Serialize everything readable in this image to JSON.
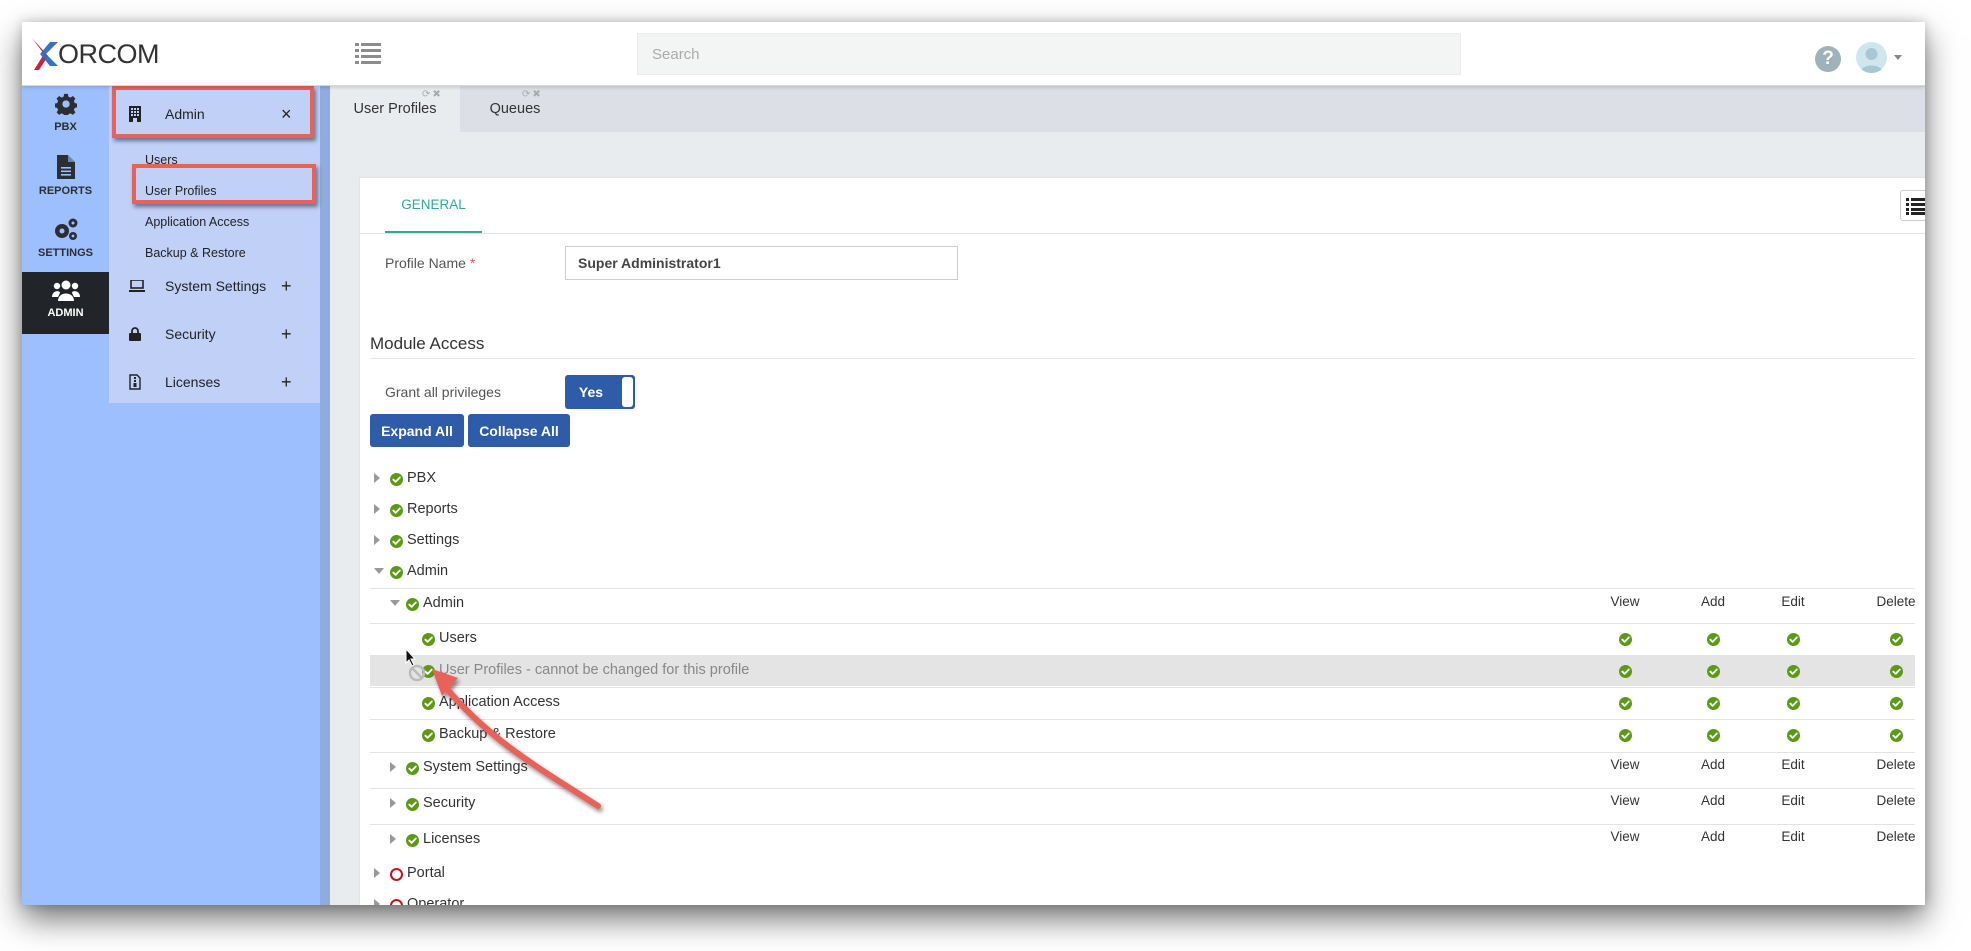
{
  "header": {
    "logo_x": "X",
    "logo_text": "ORCOM",
    "search_placeholder": "Search",
    "search_value": ""
  },
  "iconbar": [
    {
      "label": "PBX",
      "icon": "gear-icon",
      "active": false
    },
    {
      "label": "REPORTS",
      "icon": "document-icon",
      "active": false
    },
    {
      "label": "SETTINGS",
      "icon": "gears-icon",
      "active": false
    },
    {
      "label": "ADMIN",
      "icon": "users-icon",
      "active": true
    }
  ],
  "submenu": {
    "admin": {
      "label": "Admin",
      "action": "×",
      "icon": "building-icon"
    },
    "admin_items": [
      "Users",
      "User Profiles",
      "Application Access",
      "Backup & Restore"
    ],
    "sections": [
      {
        "label": "System Settings",
        "action": "+",
        "icon": "laptop-icon"
      },
      {
        "label": "Security",
        "action": "+",
        "icon": "lock-icon"
      },
      {
        "label": "Licenses",
        "action": "+",
        "icon": "file-zip-icon"
      }
    ]
  },
  "tabs": [
    {
      "label": "User Profiles",
      "active": true
    },
    {
      "label": "Queues",
      "active": false
    }
  ],
  "content": {
    "tab_label": "GENERAL",
    "profile_name_label": "Profile Name",
    "required_mark": "*",
    "profile_name_value": "Super Administrator1",
    "section_title": "Module Access",
    "grant_label": "Grant all privileges",
    "grant_value": "Yes",
    "expand_all": "Expand All",
    "collapse_all": "Collapse All"
  },
  "permissions": {
    "columns": [
      "View",
      "Add",
      "Edit",
      "Delete"
    ]
  },
  "tree": [
    {
      "label": "PBX",
      "level": 0,
      "state": "collapsed",
      "checked": true
    },
    {
      "label": "Reports",
      "level": 0,
      "state": "collapsed",
      "checked": true
    },
    {
      "label": "Settings",
      "level": 0,
      "state": "collapsed",
      "checked": true
    },
    {
      "label": "Admin",
      "level": 0,
      "state": "expanded",
      "checked": true
    },
    {
      "label": "Admin",
      "level": 1,
      "state": "expanded",
      "checked": true,
      "perm_headers": true
    },
    {
      "label": "Users",
      "level": 2,
      "checked": true,
      "perms": [
        true,
        true,
        true,
        true
      ]
    },
    {
      "label": "User Profiles - cannot be changed for this profile",
      "level": 2,
      "checked": true,
      "disabled": true,
      "perms": [
        true,
        true,
        true,
        true
      ]
    },
    {
      "label": "Application Access",
      "level": 2,
      "checked": true,
      "perms": [
        true,
        true,
        true,
        true
      ]
    },
    {
      "label": "Backup & Restore",
      "level": 2,
      "checked": true,
      "perms": [
        true,
        true,
        true,
        true
      ]
    },
    {
      "label": "System Settings",
      "level": 1,
      "state": "collapsed",
      "checked": true,
      "perm_headers": true
    },
    {
      "label": "Security",
      "level": 1,
      "state": "collapsed",
      "checked": true,
      "perm_headers": true
    },
    {
      "label": "Licenses",
      "level": 1,
      "state": "collapsed",
      "checked": true,
      "perm_headers": true
    },
    {
      "label": "Portal",
      "level": 0,
      "state": "collapsed",
      "checked": false
    },
    {
      "label": "Operator",
      "level": 0,
      "state": "collapsed",
      "checked": false
    }
  ],
  "colors": {
    "accent": "#2eaa98",
    "primary_button": "#2f5ca8",
    "check_green": "#5b9a14",
    "unchecked_red": "#c0161d",
    "highlight_annotation": "#e8625a",
    "sidebar_blue": "#9ebffd",
    "submenu_blue": "#c0d0f7"
  }
}
